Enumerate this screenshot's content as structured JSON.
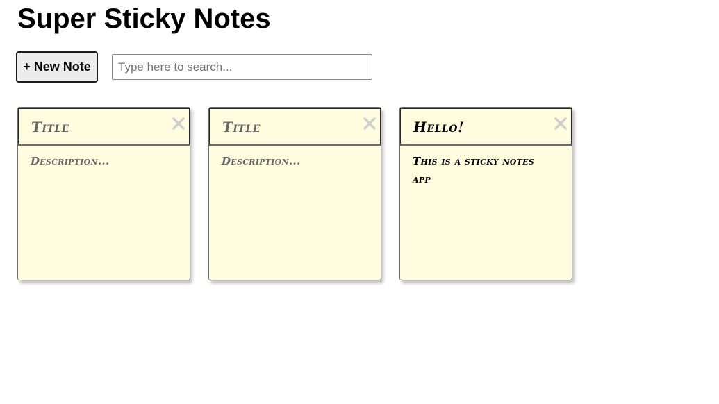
{
  "app": {
    "title": "Super Sticky Notes"
  },
  "toolbar": {
    "new_note_label": "+ New Note",
    "search_placeholder": "Type here to search...",
    "search_value": ""
  },
  "notes": [
    {
      "title": "Title",
      "description": "Description...",
      "is_placeholder": true
    },
    {
      "title": "Title",
      "description": "Description...",
      "is_placeholder": true
    },
    {
      "title": "Hello!",
      "description": "This is a sticky notes app",
      "is_placeholder": false
    }
  ],
  "colors": {
    "note_background": "#fffde0",
    "placeholder_text": "#666666",
    "close_icon": "#cfcfcf"
  },
  "icons": {
    "close": "close-icon"
  }
}
